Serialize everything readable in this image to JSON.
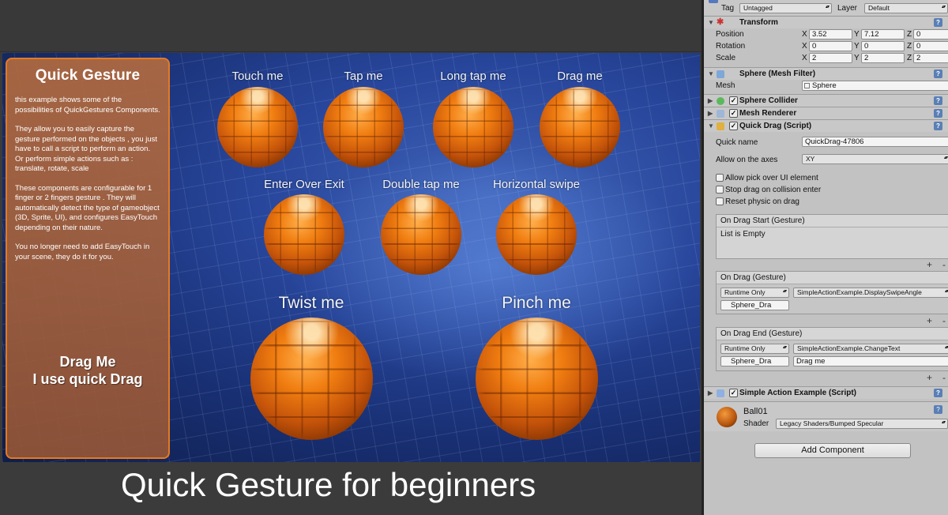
{
  "scene": {
    "panel_title": "Quick Gesture",
    "panel_paragraphs": [
      "this example shows some of the possibilities of QuickGestures Components.",
      "They allow you to easily capture the gesture performed on the objects , you just have to call a script to perform an action. Or perform simple actions such as : translate, rotate, scale",
      "These components are configurable for 1 finger or 2 fingers gesture . They will automatically detect the type of gameobject (3D, Sprite, UI), and configures EasyTouch depending on their nature.",
      "You no longer need to add  EasyTouch in your scene, they do it  for you."
    ],
    "drag_line1": "Drag Me",
    "drag_line2": "I use quick Drag",
    "labels": {
      "touch": "Touch me",
      "tap": "Tap me",
      "longtap": "Long tap me",
      "drag": "Drag me",
      "enterover": "Enter Over Exit",
      "doubletap": "Double tap me",
      "hswipe": "Horizontal swipe",
      "twist": "Twist me",
      "pinch": "Pinch me"
    }
  },
  "caption": "Quick Gesture for beginners",
  "inspector": {
    "tag_label": "Tag",
    "tag_value": "Untagged",
    "layer_label": "Layer",
    "layer_value": "Default",
    "transform": {
      "title": "Transform",
      "position_label": "Position",
      "rotation_label": "Rotation",
      "scale_label": "Scale",
      "x": "X",
      "y": "Y",
      "z": "Z",
      "position": [
        "3.52",
        "7.12",
        "0"
      ],
      "rotation": [
        "0",
        "0",
        "0"
      ],
      "scale": [
        "2",
        "2",
        "2"
      ]
    },
    "mesh_filter": {
      "title": "Sphere (Mesh Filter)",
      "mesh_label": "Mesh",
      "mesh_value": "Sphere"
    },
    "sphere_collider": "Sphere Collider",
    "mesh_renderer": "Mesh Renderer",
    "quick_drag": {
      "title": "Quick Drag (Script)",
      "quick_name_label": "Quick name",
      "quick_name_value": "QuickDrag-47806",
      "axes_label": "Allow on the axes",
      "axes_value": "XY",
      "opt1": "Allow pick over UI element",
      "opt2": "Stop drag on collision enter",
      "opt3": "Reset physic on drag",
      "ev_start_title": "On Drag Start (Gesture)",
      "ev_start_empty": "List is Empty",
      "ev_drag_title": "On Drag (Gesture)",
      "ev_drag_runtime": "Runtime Only",
      "ev_drag_func": "SimpleActionExample.DisplaySwipeAngle",
      "ev_drag_obj": "Sphere_Dra",
      "ev_end_title": "On Drag End (Gesture)",
      "ev_end_runtime": "Runtime Only",
      "ev_end_func": "SimpleActionExample.ChangeText",
      "ev_end_obj": "Sphere_Dra",
      "ev_end_arg": "Drag me",
      "plus": "+",
      "minus": "-"
    },
    "simple_action": "Simple Action Example (Script)",
    "material": {
      "name": "Ball01",
      "shader_label": "Shader",
      "shader_value": "Legacy Shaders/Bumped Specular"
    },
    "add_component": "Add Component"
  }
}
